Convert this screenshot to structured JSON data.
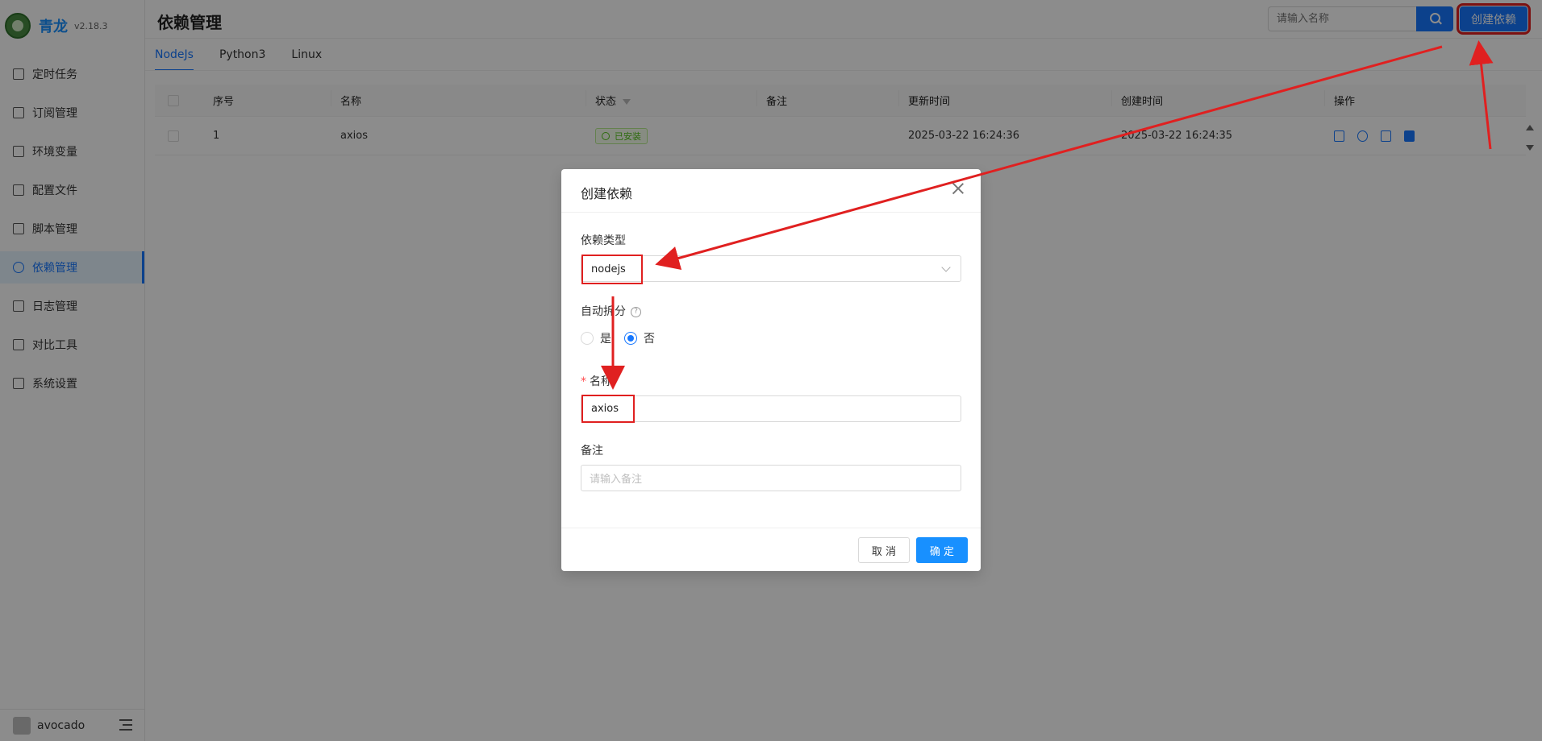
{
  "app": {
    "name": "青龙",
    "version": "v2.18.3"
  },
  "sidebar": {
    "items": [
      {
        "label": "定时任务",
        "icon": "clock-file-icon"
      },
      {
        "label": "订阅管理",
        "icon": "subscribe-icon"
      },
      {
        "label": "环境变量",
        "icon": "monitor-icon"
      },
      {
        "label": "配置文件",
        "icon": "sliders-icon"
      },
      {
        "label": "脚本管理",
        "icon": "script-icon"
      },
      {
        "label": "依赖管理",
        "icon": "dependency-icon",
        "active": true
      },
      {
        "label": "日志管理",
        "icon": "log-icon"
      },
      {
        "label": "对比工具",
        "icon": "diff-icon"
      },
      {
        "label": "系统设置",
        "icon": "gear-icon"
      }
    ],
    "user": "avocado"
  },
  "header": {
    "title": "依赖管理",
    "search_placeholder": "请输入名称",
    "create_label": "创建依赖"
  },
  "tabs": [
    {
      "label": "NodeJs",
      "active": true
    },
    {
      "label": "Python3"
    },
    {
      "label": "Linux"
    }
  ],
  "table": {
    "columns": [
      "序号",
      "名称",
      "状态",
      "备注",
      "更新时间",
      "创建时间",
      "操作"
    ],
    "rows": [
      {
        "index": "1",
        "name": "axios",
        "status": "已安装",
        "remark": "",
        "updated": "2025-03-22 16:24:36",
        "created": "2025-03-22 16:24:35"
      }
    ]
  },
  "modal": {
    "title": "创建依赖",
    "type_label": "依赖类型",
    "type_value": "nodejs",
    "split_label": "自动拆分",
    "split_help": "?",
    "split_yes": "是",
    "split_no": "否",
    "name_label": "名称",
    "name_required": "*",
    "name_value": "axios",
    "remark_label": "备注",
    "remark_placeholder": "请输入备注",
    "cancel_label": "取 消",
    "ok_label": "确 定"
  },
  "colors": {
    "primary": "#1677ff",
    "annotation": "#e02020",
    "success": "#52c41a"
  }
}
